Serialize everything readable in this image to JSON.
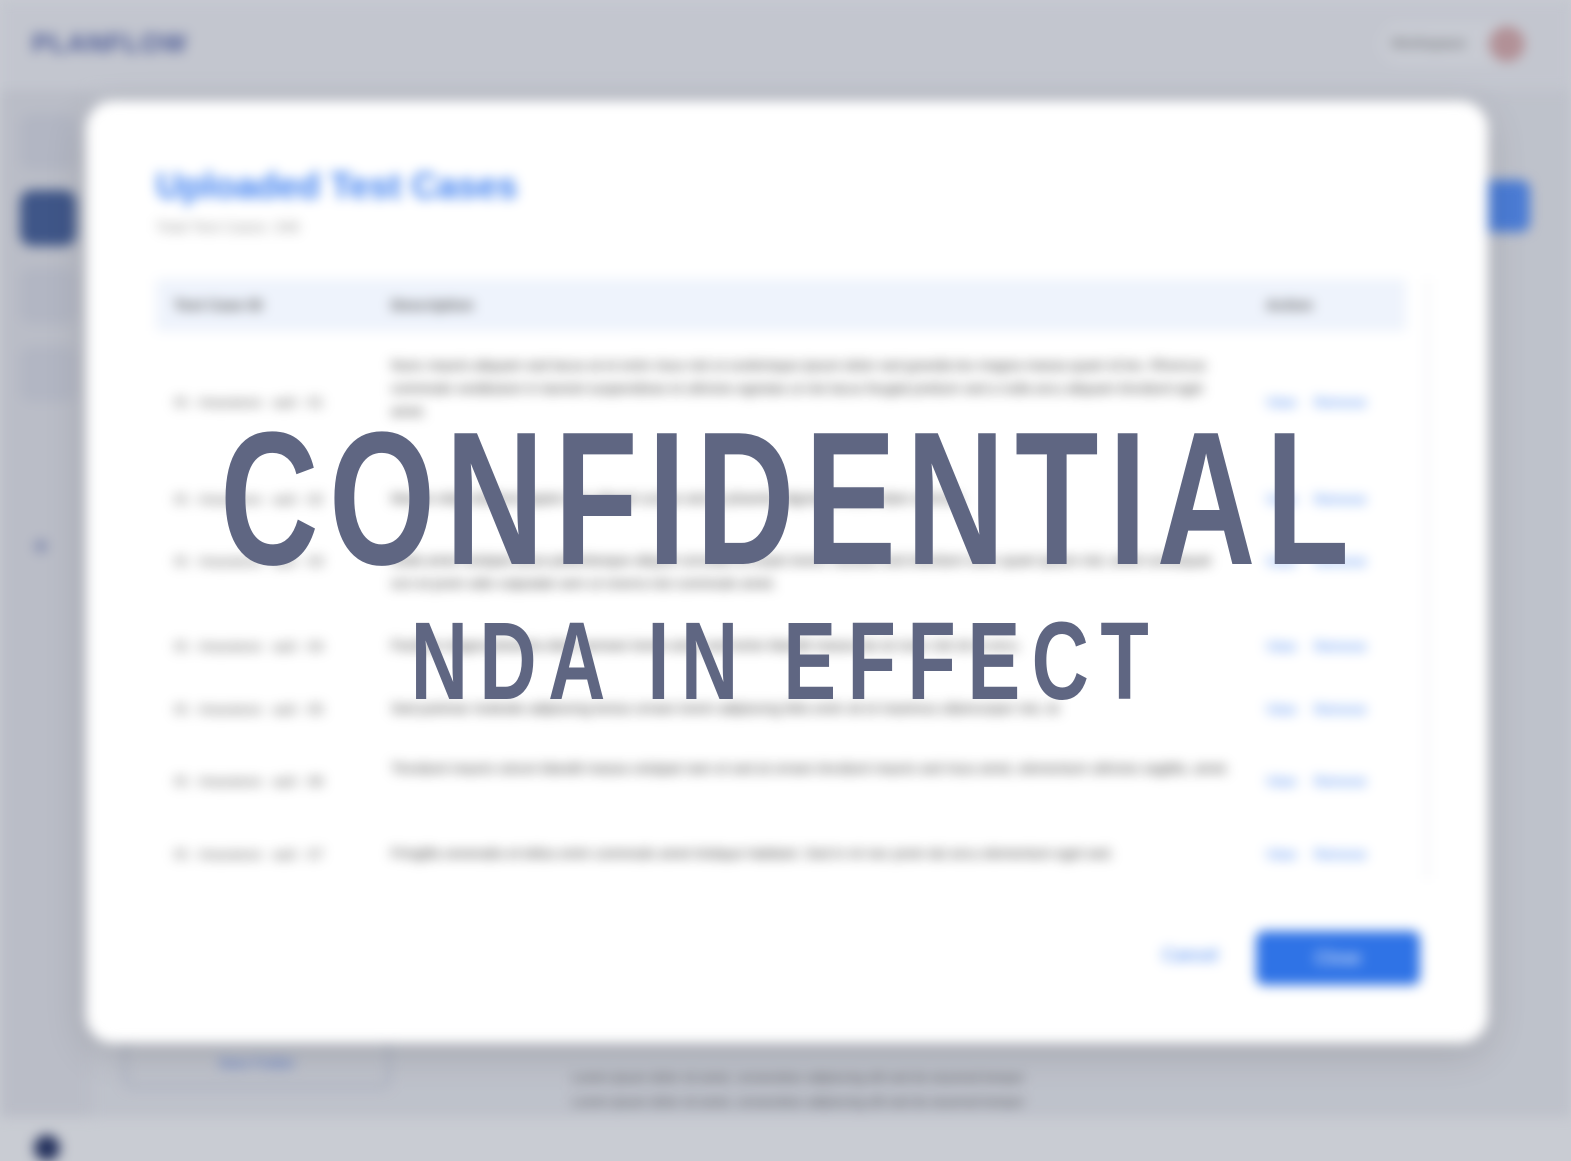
{
  "app": {
    "brand": "PLANFLOW",
    "user_name": "Workspace"
  },
  "sidebar": {
    "new_folder_label": "New Folder"
  },
  "background_text": [
    "Lorem ipsum dolor sit amet, consectetur adipiscing elit sed do eiusmod tempor",
    "Lorem ipsum dolor sit amet, consectetur adipiscing elit sed do eiusmod tempor"
  ],
  "modal": {
    "title": "Uploaded Test Cases",
    "subtitle": "Total Test Cases: 348",
    "columns": [
      "Test Case ID",
      "Description",
      "Action"
    ],
    "rows": [
      {
        "id": "IS - Insurance - auli - 01",
        "desc": "Nunc mauris aliquam sed lacus at et enim risus nisl ut scelerisque ipsum dolor sed gravida leo magna massa quam id leo. Rhoncus commodo vestibulum in laoreet suspendisse et ultricies egestas ut nisi lacus feugiat pretium sed a nulla arcu aliquam tincidunt eget amet.",
        "view": "View",
        "remove": "Remove"
      },
      {
        "id": "IS - Insurance - auli - 02",
        "desc": "Mauris vitae eleifend sapien nec aliquet cursus sed ut pharetra dignissim nunc diam ultricies.",
        "view": "View",
        "remove": "Remove"
      },
      {
        "id": "IS - Insurance - auli - 03",
        "desc": "Nulla amet volutpat lacus pellentesque aliquet convallis et turpis lorem, facilisis sed interdum nunc quam ipsum nisl, amet consequat orci et proin odio vulputate sem ut viverra nisi commodo amet.",
        "view": "View",
        "remove": "Remove"
      },
      {
        "id": "IS - Insurance - auli - 04",
        "desc": "Facilisis magna pharetra diam aenean lorem amet sed tortor blandit massa dui at nunc nisl sit ut arcu.",
        "view": "View",
        "remove": "Remove"
      },
      {
        "id": "IS - Insurance - auli - 05",
        "desc": "Sed pulvinar molestie adipiscing lectus ornare lorem adipiscing felis enim sit et maximus ullamcorper nisi, id.",
        "view": "View",
        "remove": "Remove"
      },
      {
        "id": "IS - Insurance - auli - 06",
        "desc": "Tincidunt mauris rutrum blandit massa volutpat nam et sed at ornare tincidunt mauris sed risus amet, elementum ultricies sagittis, amet.",
        "view": "View",
        "remove": "Remove"
      },
      {
        "id": "IS - Insurance - auli - 07",
        "desc": "Fringilla venenatis et tellus enim commodo amet tristique habitant. Sed in mi nec proin dui arcu elementum eget sed.",
        "view": "View",
        "remove": "Remove"
      }
    ],
    "cancel_label": "Cancel",
    "close_label": "Close"
  },
  "watermark": {
    "main": "CONFIDENTIAL",
    "sub": "NDA IN EFFECT"
  },
  "colors": {
    "accent": "#2f73e6",
    "title": "#3b7ef0",
    "watermark": "#5f6682"
  }
}
